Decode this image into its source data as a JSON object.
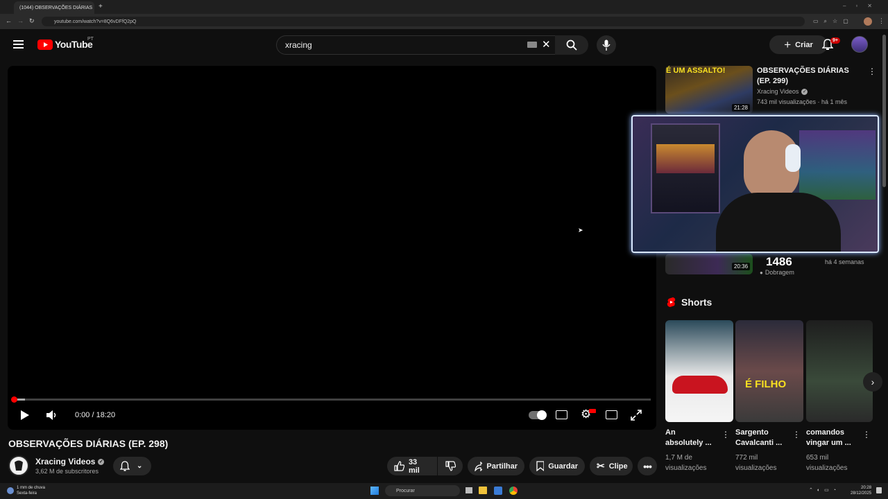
{
  "browser": {
    "tab_title": "(1044) OBSERVAÇÕES DIÁRIAS",
    "url": "youtube.com/watch?v=8Q6vDFfQ2pQ"
  },
  "header": {
    "logo_text": "YouTube",
    "region": "PT",
    "search_value": "xracing",
    "create_label": "Criar",
    "notification_count": "9+"
  },
  "player": {
    "time": "0:00 / 18:20",
    "progress_fraction": 0.017
  },
  "video": {
    "title": "OBSERVAÇÕES DIÁRIAS (EP. 298)",
    "channel": "Xracing Videos",
    "subscribers": "3,62 M de subscritores",
    "likes": "33 mil",
    "share_label": "Partilhar",
    "save_label": "Guardar",
    "clip_label": "Clipe"
  },
  "recommended": {
    "item1": {
      "title": "OBSERVAÇÕES DIÁRIAS (EP. 299)",
      "channel": "Xracing Videos",
      "meta": "743 mil visualizações · há 1 mês",
      "duration": "21:28",
      "thumb_text": "É UM ASSALTO!"
    },
    "item2": {
      "duration": "20:36",
      "counter": "1486",
      "meta": "há 4 semanas",
      "badge": "Dobragem"
    }
  },
  "shorts": {
    "heading": "Shorts",
    "items": [
      {
        "title1": "An",
        "title2": "absolutely ...",
        "views1": "1,7 M de",
        "views2": "visualizações"
      },
      {
        "title1": "Sargento",
        "title2": "Cavalcanti ...",
        "views1": "772 mil",
        "views2": "visualizações",
        "thumb_text": "É FILHO"
      },
      {
        "title1": "comandos",
        "title2": "vingar um ...",
        "views1": "653 mil",
        "views2": "visualizações"
      }
    ]
  },
  "taskbar": {
    "weather1": "1 mm de chuva",
    "weather2": "Sexta-feira",
    "search_label": "Procurar",
    "time": "20:28",
    "date": "28/12/2025"
  }
}
